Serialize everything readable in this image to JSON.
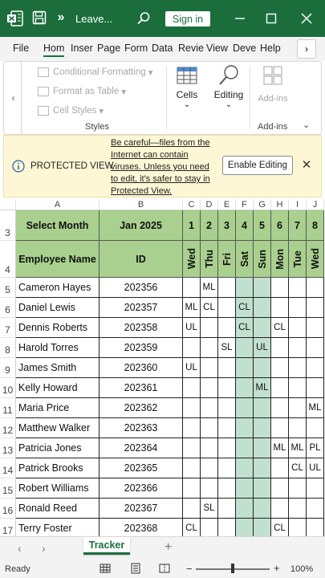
{
  "titlebar": {
    "title": "Leave...",
    "sign_in": "Sign in",
    "more": "»"
  },
  "tabs": [
    "File",
    "Hom",
    "Inser",
    "Page",
    "Form",
    "Data",
    "Revie",
    "View",
    "Deve",
    "Help"
  ],
  "ribbon": {
    "conditional_formatting": "Conditional Formatting",
    "format_as_table": "Format as Table",
    "cell_styles": "Cell Styles",
    "styles_group": "Styles",
    "cells": "Cells",
    "editing": "Editing",
    "addins_button": "Add-ins",
    "addins_group": "Add-ins"
  },
  "protected_view": {
    "title": "PROTECTED VIEW",
    "message": "Be careful—files from the Internet can contain viruses. Unless you need to edit, it's safer to stay in Protected View.",
    "button": "Enable Editing"
  },
  "sheet": {
    "columns": [
      "A",
      "B",
      "C",
      "D",
      "E",
      "F",
      "G",
      "H",
      "I",
      "J"
    ],
    "row_numbers": [
      "3",
      "4",
      "5",
      "6",
      "7",
      "8",
      "9",
      "10",
      "11",
      "12",
      "13",
      "14",
      "15",
      "16",
      "17"
    ],
    "select_month_label": "Select Month",
    "month_value": "Jan 2025",
    "name_header": "Employee Name",
    "id_header": "ID",
    "day_numbers": [
      "1",
      "2",
      "3",
      "4",
      "5",
      "6",
      "7",
      "8"
    ],
    "weekdays": [
      "Wed",
      "Thu",
      "Fri",
      "Sat",
      "Sun",
      "Mon",
      "Tue",
      "Wed"
    ],
    "employees": [
      {
        "name": "Cameron Hayes",
        "id": "202356",
        "days": [
          "",
          "ML",
          "",
          "",
          "",
          "",
          "",
          ""
        ]
      },
      {
        "name": "Daniel Lewis",
        "id": "202357",
        "days": [
          "ML",
          "CL",
          "",
          "CL",
          "",
          "",
          "",
          ""
        ]
      },
      {
        "name": "Dennis Roberts",
        "id": "202358",
        "days": [
          "UL",
          "",
          "",
          "CL",
          "",
          "CL",
          "",
          ""
        ]
      },
      {
        "name": "Harold Torres",
        "id": "202359",
        "days": [
          "",
          "",
          "SL",
          "",
          "UL",
          "",
          "",
          ""
        ]
      },
      {
        "name": "James Smith",
        "id": "202360",
        "days": [
          "UL",
          "",
          "",
          "",
          "",
          "",
          "",
          ""
        ]
      },
      {
        "name": "Kelly Howard",
        "id": "202361",
        "days": [
          "",
          "",
          "",
          "",
          "ML",
          "",
          "",
          ""
        ]
      },
      {
        "name": "Maria Price",
        "id": "202362",
        "days": [
          "",
          "",
          "",
          "",
          "",
          "",
          "",
          "ML"
        ]
      },
      {
        "name": "Matthew Walker",
        "id": "202363",
        "days": [
          "",
          "",
          "",
          "",
          "",
          "",
          "",
          ""
        ]
      },
      {
        "name": "Patricia Jones",
        "id": "202364",
        "days": [
          "",
          "",
          "",
          "",
          "",
          "ML",
          "ML",
          "PL"
        ]
      },
      {
        "name": "Patrick Brooks",
        "id": "202365",
        "days": [
          "",
          "",
          "",
          "",
          "",
          "",
          "CL",
          "UL"
        ]
      },
      {
        "name": "Robert Williams",
        "id": "202366",
        "days": [
          "",
          "",
          "",
          "",
          "",
          "",
          "",
          ""
        ]
      },
      {
        "name": "Ronald Reed",
        "id": "202367",
        "days": [
          "",
          "SL",
          "",
          "",
          "",
          "",
          "",
          ""
        ]
      },
      {
        "name": "Terry Foster",
        "id": "202368",
        "days": [
          "CL",
          "",
          "",
          "",
          "",
          "CL",
          "",
          ""
        ]
      }
    ],
    "weekend_fill": "#c2e0cf",
    "header_fill": "#a9d08e"
  },
  "sheet_tab": "Tracker",
  "status": {
    "ready": "Ready",
    "zoom": "100%",
    "zoom_level": 0.5
  },
  "colors": {
    "brand": "#1b6e3c",
    "protected_bar": "#fdf7d5"
  }
}
